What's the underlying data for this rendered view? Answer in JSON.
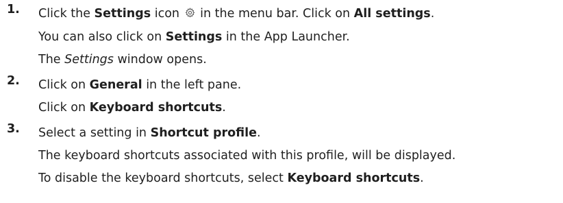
{
  "steps": [
    {
      "number": "1.",
      "lines": [
        {
          "pre": "Click the ",
          "b1": "Settings",
          "mid": " icon ",
          "icon": "gear-icon",
          "post": " in the menu bar. Click on ",
          "b2": "All settings",
          "end": "."
        },
        {
          "pre": "You can also click on ",
          "b1": "Settings",
          "post": " in the App Launcher."
        },
        {
          "pre": "The ",
          "i1": "Settings",
          "post": " window opens."
        }
      ]
    },
    {
      "number": "2.",
      "lines": [
        {
          "pre": "Click on ",
          "b1": "General",
          "post": " in the left pane."
        },
        {
          "pre": "Click on ",
          "b1": "Keyboard shortcuts",
          "post": "."
        }
      ]
    },
    {
      "number": "3.",
      "lines": [
        {
          "pre": "Select a setting in ",
          "b1": "Shortcut profile",
          "post": "."
        },
        {
          "text": "The keyboard shortcuts associated with this profile, will be displayed."
        },
        {
          "pre": "To disable the keyboard shortcuts, select ",
          "b1": "Keyboard shortcuts",
          "post": "."
        }
      ]
    }
  ]
}
